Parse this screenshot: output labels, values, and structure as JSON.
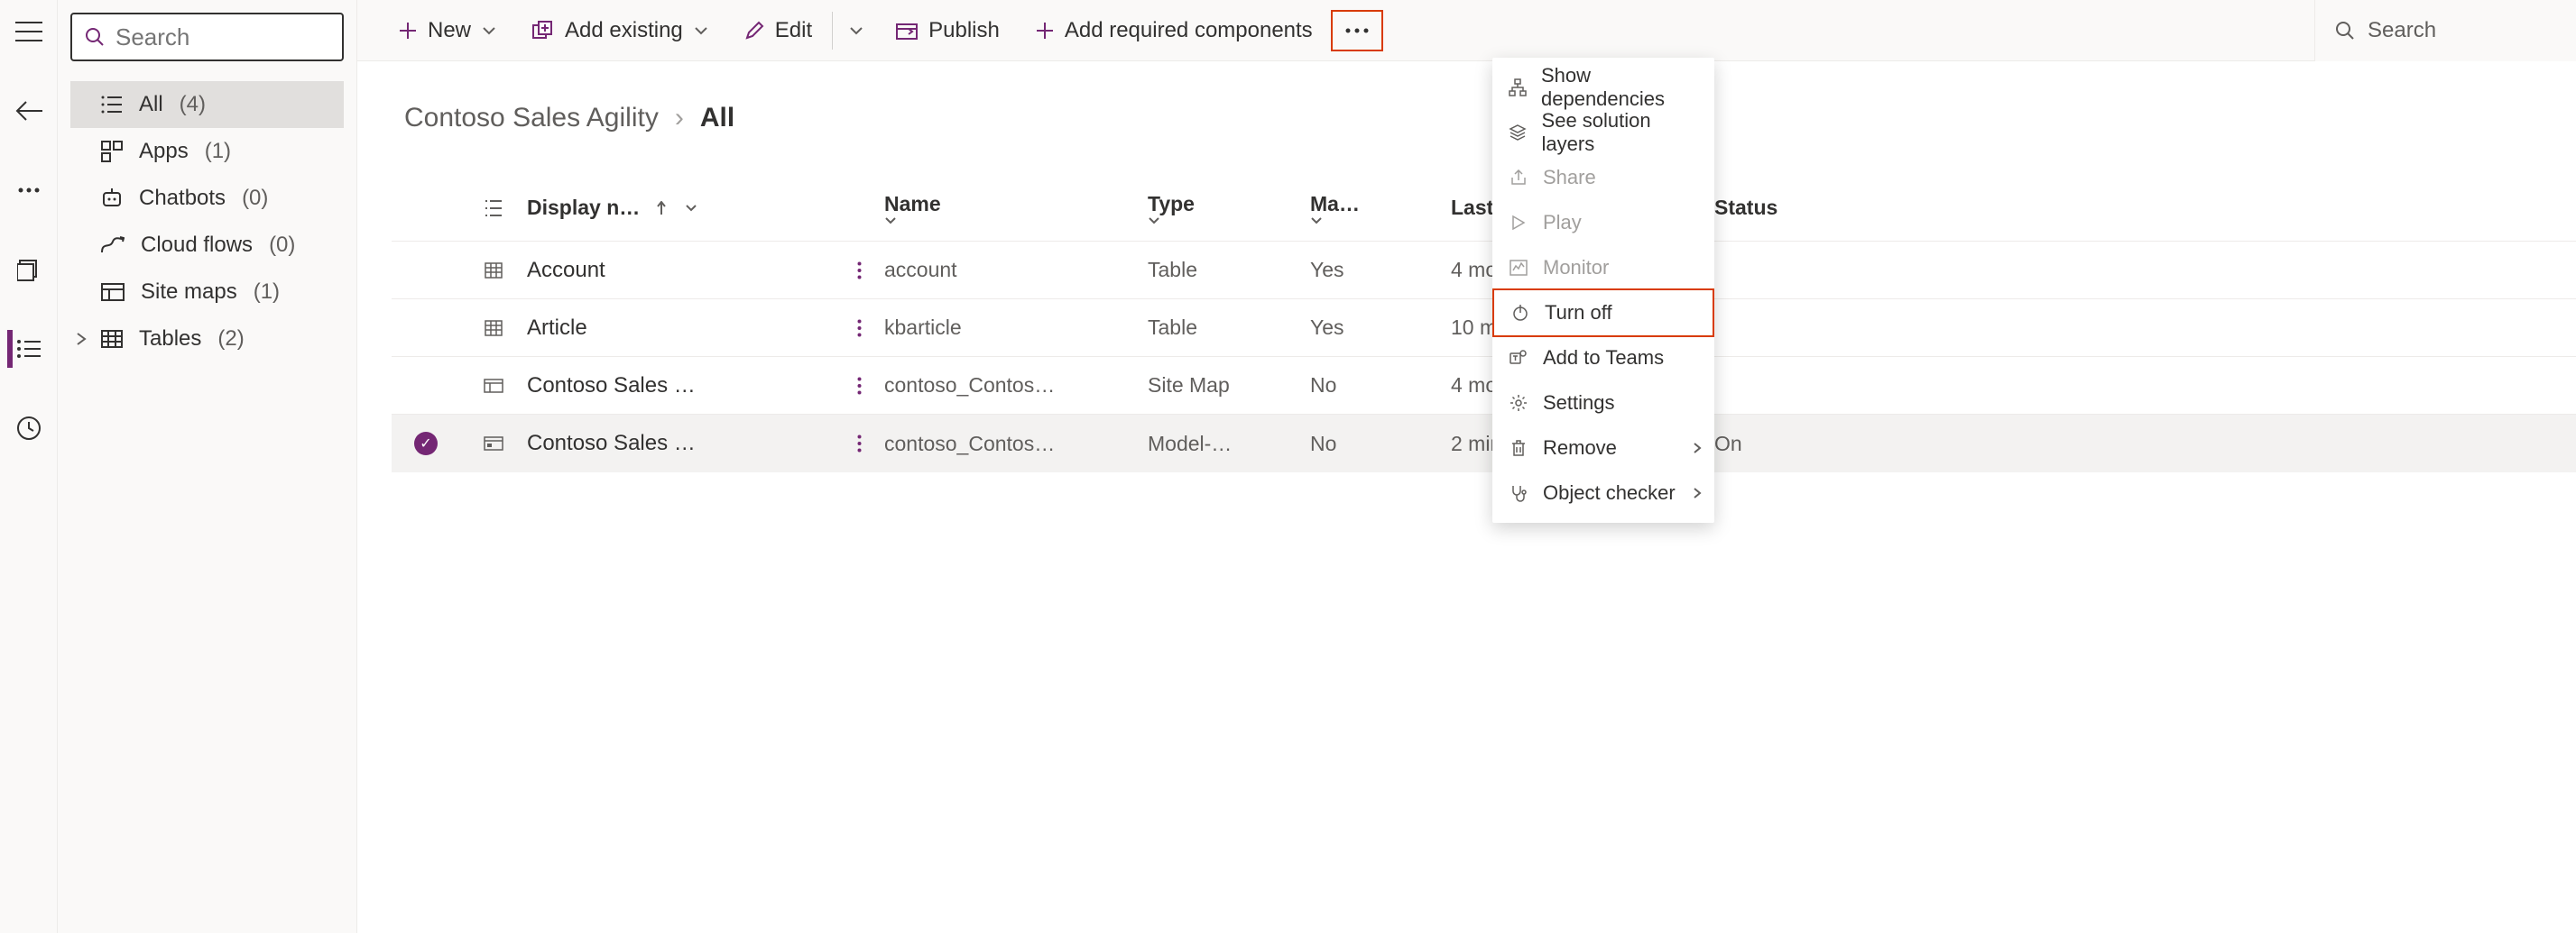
{
  "search": {
    "placeholder": "Search"
  },
  "sidebar": {
    "items": [
      {
        "label": "All",
        "count": "(4)"
      },
      {
        "label": "Apps",
        "count": "(1)"
      },
      {
        "label": "Chatbots",
        "count": "(0)"
      },
      {
        "label": "Cloud flows",
        "count": "(0)"
      },
      {
        "label": "Site maps",
        "count": "(1)"
      },
      {
        "label": "Tables",
        "count": "(2)"
      }
    ]
  },
  "commands": {
    "new": "New",
    "add_existing": "Add existing",
    "edit": "Edit",
    "publish": "Publish",
    "add_required": "Add required components",
    "search": "Search"
  },
  "breadcrumb": {
    "root": "Contoso Sales Agility",
    "current": "All"
  },
  "table": {
    "headers": {
      "display": "Display n…",
      "name": "Name",
      "type": "Type",
      "managed": "Ma…",
      "modified": "Last Moc",
      "status": "Status"
    },
    "rows": [
      {
        "display": "Account",
        "name": "account",
        "type": "Table",
        "managed": "Yes",
        "modified": "4 months",
        "status": "",
        "icon": "table"
      },
      {
        "display": "Article",
        "name": "kbarticle",
        "type": "Table",
        "managed": "Yes",
        "modified": "10 months",
        "status": "",
        "icon": "table"
      },
      {
        "display": "Contoso Sales …",
        "name": "contoso_Contos…",
        "type": "Site Map",
        "managed": "No",
        "modified": "4 months",
        "status": "",
        "icon": "sitemap"
      },
      {
        "display": "Contoso Sales …",
        "name": "contoso_Contos…",
        "type": "Model-…",
        "managed": "No",
        "modified": "2 minutes",
        "status": "On",
        "icon": "app",
        "selected": true
      }
    ]
  },
  "context_menu": {
    "items": [
      {
        "label": "Show dependencies",
        "icon": "tree"
      },
      {
        "label": "See solution layers",
        "icon": "layers"
      },
      {
        "label": "Share",
        "icon": "share",
        "disabled": true
      },
      {
        "label": "Play",
        "icon": "play",
        "disabled": true
      },
      {
        "label": "Monitor",
        "icon": "monitor",
        "disabled": true
      },
      {
        "label": "Turn off",
        "icon": "power",
        "highlight": true
      },
      {
        "label": "Add to Teams",
        "icon": "teams"
      },
      {
        "label": "Settings",
        "icon": "gear"
      },
      {
        "label": "Remove",
        "icon": "trash",
        "chevron": true
      },
      {
        "label": "Object checker",
        "icon": "stetho",
        "chevron": true
      }
    ]
  }
}
